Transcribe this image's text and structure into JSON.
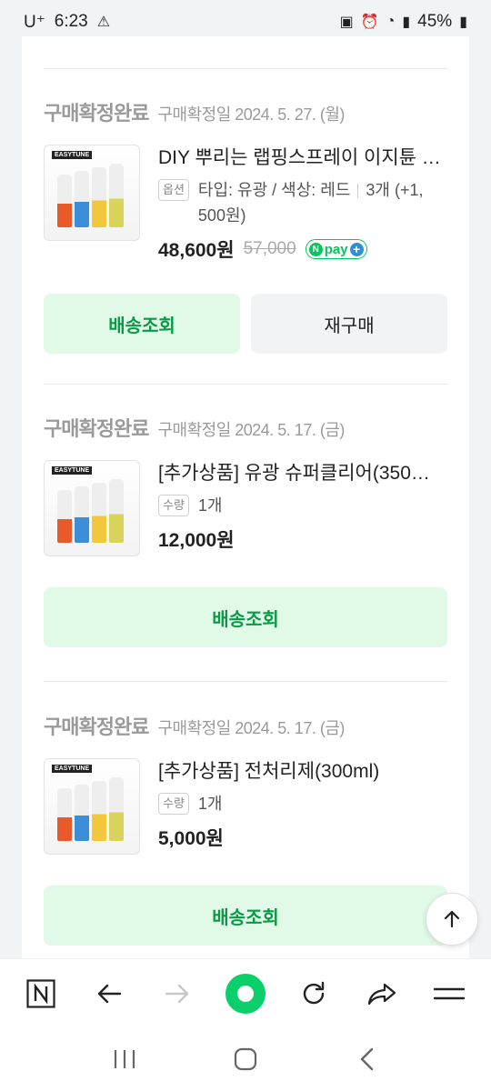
{
  "status_bar": {
    "carrier": "U⁺",
    "time": "6:23",
    "battery": "45%"
  },
  "orders": [
    {
      "status": "구매확정완료",
      "date": "구매확정일 2024. 5. 27. (월)",
      "product_title": "DIY 뿌리는 랩핑스프레이 이지튠 …",
      "option_tag": "옵션",
      "option_text": "타입: 유광 / 색상: 레드",
      "quantity": "3개 (+1, 500원)",
      "price": "48,600원",
      "original_price": "57,000",
      "npay_label": "pay",
      "buttons": [
        "배송조회",
        "재구매"
      ]
    },
    {
      "status": "구매확정완료",
      "date": "구매확정일 2024. 5. 17. (금)",
      "product_title": "[추가상품] 유광 슈퍼클리어(350…",
      "option_tag": "수량",
      "quantity": "1개",
      "price": "12,000원",
      "buttons": [
        "배송조회"
      ]
    },
    {
      "status": "구매확정완료",
      "date": "구매확정일 2024. 5. 17. (금)",
      "product_title": "[추가상품] 전처리제(300ml)",
      "option_tag": "수량",
      "quantity": "1개",
      "price": "5,000원",
      "buttons": [
        "배송조회"
      ]
    }
  ],
  "thumbnail_logo": "EASYTUNE",
  "colors": {
    "accent_green": "#03c75a",
    "button_green_bg": "#e1f9e7",
    "button_green_text": "#0a9a47",
    "muted_text": "#9a9a9a"
  },
  "icons": {
    "browser_bar": [
      "naver-n-icon",
      "back-arrow-icon",
      "forward-arrow-icon",
      "green-dot-icon",
      "refresh-icon",
      "share-icon",
      "menu-icon"
    ],
    "android_nav": [
      "recent-apps-icon",
      "home-icon",
      "back-icon"
    ]
  }
}
